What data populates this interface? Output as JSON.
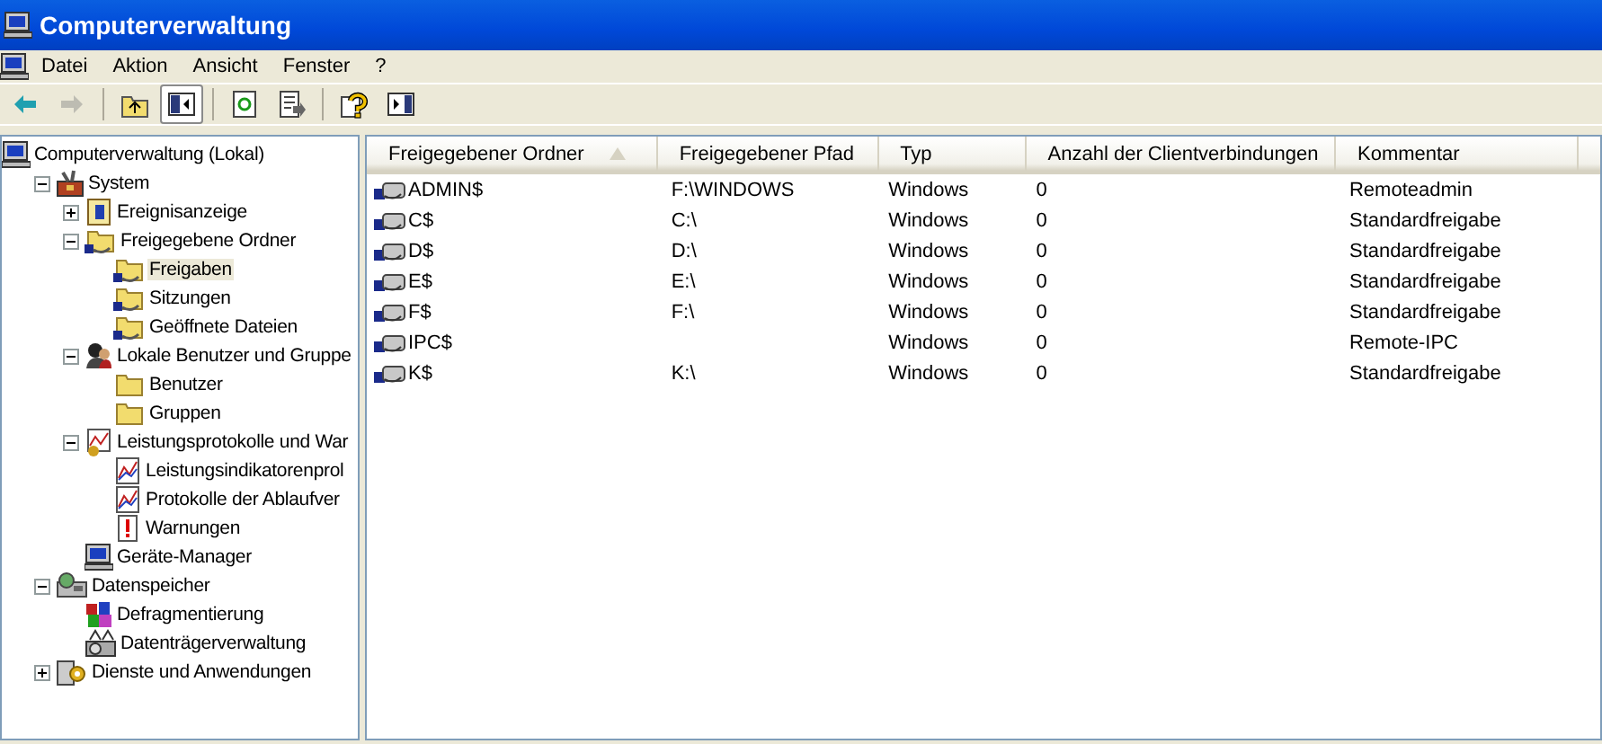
{
  "window": {
    "title": "Computerverwaltung"
  },
  "menu": [
    "Datei",
    "Aktion",
    "Ansicht",
    "Fenster",
    "?"
  ],
  "toolbar": [
    {
      "kind": "back",
      "disabled": false,
      "pressed": false
    },
    {
      "kind": "forward",
      "disabled": true,
      "pressed": false
    },
    {
      "kind": "sep"
    },
    {
      "kind": "up",
      "disabled": false,
      "pressed": false
    },
    {
      "kind": "tree",
      "disabled": false,
      "pressed": true
    },
    {
      "kind": "sep"
    },
    {
      "kind": "refresh",
      "disabled": false,
      "pressed": false
    },
    {
      "kind": "export",
      "disabled": false,
      "pressed": false
    },
    {
      "kind": "sep"
    },
    {
      "kind": "help",
      "disabled": false,
      "pressed": false
    },
    {
      "kind": "panel",
      "disabled": false,
      "pressed": false
    }
  ],
  "tree": [
    {
      "label": "Computerverwaltung (Lokal)",
      "kind": "computer",
      "selected": false,
      "children": [
        {
          "label": "System",
          "kind": "tools",
          "expanded": true,
          "selected": false,
          "children": [
            {
              "label": "Ereignisanzeige",
              "kind": "log",
              "expanded": false,
              "selected": false
            },
            {
              "label": "Freigegebene Ordner",
              "kind": "share",
              "expanded": true,
              "selected": false,
              "children": [
                {
                  "label": "Freigaben",
                  "kind": "share",
                  "selected": true
                },
                {
                  "label": "Sitzungen",
                  "kind": "share",
                  "selected": false
                },
                {
                  "label": "Geöffnete Dateien",
                  "kind": "share",
                  "selected": false
                }
              ]
            },
            {
              "label": "Lokale Benutzer und Gruppe",
              "kind": "users",
              "expanded": true,
              "selected": false,
              "children": [
                {
                  "label": "Benutzer",
                  "kind": "folder",
                  "selected": false
                },
                {
                  "label": "Gruppen",
                  "kind": "folder",
                  "selected": false
                }
              ]
            },
            {
              "label": "Leistungsprotokolle und War",
              "kind": "perf",
              "expanded": true,
              "selected": false,
              "children": [
                {
                  "label": "Leistungsindikatorenprol",
                  "kind": "chart",
                  "selected": false
                },
                {
                  "label": "Protokolle der Ablaufver",
                  "kind": "chart",
                  "selected": false
                },
                {
                  "label": "Warnungen",
                  "kind": "alert",
                  "selected": false
                }
              ]
            },
            {
              "label": "Geräte-Manager",
              "kind": "computer",
              "selected": false
            }
          ]
        },
        {
          "label": "Datenspeicher",
          "kind": "storage",
          "expanded": true,
          "selected": false,
          "children": [
            {
              "label": "Defragmentierung",
              "kind": "defrag",
              "selected": false
            },
            {
              "label": "Datenträgerverwaltung",
              "kind": "disk",
              "selected": false
            }
          ]
        },
        {
          "label": "Dienste und Anwendungen",
          "kind": "services",
          "expanded": false,
          "selected": false
        }
      ]
    }
  ],
  "table": {
    "columns": [
      {
        "label": "Freigegebener Ordner",
        "sorted": true
      },
      {
        "label": "Freigegebener Pfad",
        "sorted": false
      },
      {
        "label": "Typ",
        "sorted": false
      },
      {
        "label": "Anzahl der Clientverbindungen",
        "sorted": false
      },
      {
        "label": "Kommentar",
        "sorted": false
      }
    ],
    "rows": [
      {
        "name": "ADMIN$",
        "path": "F:\\WINDOWS",
        "type": "Windows",
        "connections": "0",
        "comment": "Remoteadmin"
      },
      {
        "name": "C$",
        "path": "C:\\",
        "type": "Windows",
        "connections": "0",
        "comment": "Standardfreigabe"
      },
      {
        "name": "D$",
        "path": "D:\\",
        "type": "Windows",
        "connections": "0",
        "comment": "Standardfreigabe"
      },
      {
        "name": "E$",
        "path": "E:\\",
        "type": "Windows",
        "connections": "0",
        "comment": "Standardfreigabe"
      },
      {
        "name": "F$",
        "path": "F:\\",
        "type": "Windows",
        "connections": "0",
        "comment": "Standardfreigabe"
      },
      {
        "name": "IPC$",
        "type": "Windows",
        "connections": "0",
        "comment": "Remote-IPC"
      },
      {
        "name": "K$",
        "path": "K:\\",
        "type": "Windows",
        "connections": "0",
        "comment": "Standardfreigabe"
      }
    ]
  }
}
